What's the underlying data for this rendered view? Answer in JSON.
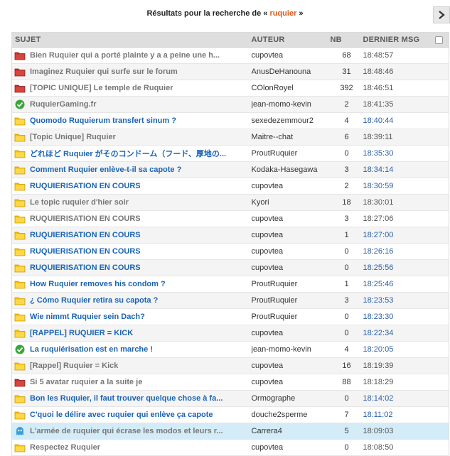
{
  "header": {
    "prefix": "Résultats pour la recherche de «",
    "query": "ruquier",
    "suffix": "»",
    "next_icon": "chevron-right-icon"
  },
  "columns": {
    "subject": "SUJET",
    "author": "AUTEUR",
    "count": "NB",
    "last": "DERNIER MSG"
  },
  "colors": {
    "folder_yellow": "#f5c000",
    "folder_red": "#c0302a",
    "check_green": "#3aa63a",
    "ghost_blue": "#3aa0d8",
    "link_blue": "#1a63b8",
    "link_grey": "#777777",
    "highlight_row": "#d4ecf7"
  },
  "topics": [
    {
      "icon": "red-folder-icon",
      "subject": "Bien Ruquier qui a porté plainte y a a peine une h...",
      "style": "grey",
      "author": "cupovtea",
      "count": "68",
      "last": "18:48:57"
    },
    {
      "icon": "red-folder-icon",
      "subject": "Imaginez Ruquier qui surfe sur le forum",
      "style": "grey",
      "author": "AnusDeHanouna",
      "count": "31",
      "last": "18:48:46"
    },
    {
      "icon": "red-folder-icon",
      "subject": "[TOPIC UNIQUE] Le temple de Ruquier",
      "style": "grey",
      "author": "COlonRoyel",
      "count": "392",
      "last": "18:46:51"
    },
    {
      "icon": "green-check-icon",
      "subject": "RuquierGaming.fr",
      "style": "grey",
      "author": "jean-momo-kevin",
      "count": "2",
      "last": "18:41:35"
    },
    {
      "icon": "yellow-folder-icon",
      "subject": "Quomodo Ruquierum transfert sinum ?",
      "style": "blue",
      "author": "sexedezemmour2",
      "count": "4",
      "last": "18:40:44"
    },
    {
      "icon": "yellow-folder-icon",
      "subject": "[Topic Unique] Ruquier",
      "style": "grey",
      "author": "Maitre--chat",
      "count": "6",
      "last": "18:39:11"
    },
    {
      "icon": "yellow-folder-icon",
      "subject": "どれほど Ruquier がそのコンドーム（フード、厚地の...",
      "style": "blue",
      "author": "ProutRuquier",
      "count": "0",
      "last": "18:35:30"
    },
    {
      "icon": "yellow-folder-icon",
      "subject": "Comment Ruquier enlève-t-il sa capote ?",
      "style": "blue",
      "author": "Kodaka-Hasegawa",
      "count": "3",
      "last": "18:34:14"
    },
    {
      "icon": "yellow-folder-icon",
      "subject": "RUQUIERISATION EN COURS",
      "style": "blue",
      "author": "cupovtea",
      "count": "2",
      "last": "18:30:59"
    },
    {
      "icon": "yellow-folder-icon",
      "subject": "Le topic ruquier d'hier soir",
      "style": "grey",
      "author": "Kyori",
      "count": "18",
      "last": "18:30:01"
    },
    {
      "icon": "yellow-folder-icon",
      "subject": "RUQUIERISATION EN COURS",
      "style": "grey",
      "author": "cupovtea",
      "count": "3",
      "last": "18:27:06"
    },
    {
      "icon": "yellow-folder-icon",
      "subject": "RUQUIERISATION EN COURS",
      "style": "blue",
      "author": "cupovtea",
      "count": "1",
      "last": "18:27:00"
    },
    {
      "icon": "yellow-folder-icon",
      "subject": "RUQUIERISATION EN COURS",
      "style": "blue",
      "author": "cupovtea",
      "count": "0",
      "last": "18:26:16"
    },
    {
      "icon": "yellow-folder-icon",
      "subject": "RUQUIERISATION EN COURS",
      "style": "blue",
      "author": "cupovtea",
      "count": "0",
      "last": "18:25:56"
    },
    {
      "icon": "yellow-folder-icon",
      "subject": "How Ruquier removes his condom ?",
      "style": "blue",
      "author": "ProutRuquier",
      "count": "1",
      "last": "18:25:46"
    },
    {
      "icon": "yellow-folder-icon",
      "subject": "¿ Cómo Ruquier retira su capota ?",
      "style": "blue",
      "author": "ProutRuquier",
      "count": "3",
      "last": "18:23:53"
    },
    {
      "icon": "yellow-folder-icon",
      "subject": "Wie nimmt Ruquier sein Dach?",
      "style": "blue",
      "author": "ProutRuquier",
      "count": "0",
      "last": "18:23:30"
    },
    {
      "icon": "yellow-folder-icon",
      "subject": "[RAPPEL] RUQUIER = KICK",
      "style": "blue",
      "author": "cupovtea",
      "count": "0",
      "last": "18:22:34"
    },
    {
      "icon": "green-check-icon",
      "subject": "La ruquiérisation est en marche !",
      "style": "blue",
      "author": "jean-momo-kevin",
      "count": "4",
      "last": "18:20:05"
    },
    {
      "icon": "yellow-folder-icon",
      "subject": "[Rappel] Ruquier = Kick",
      "style": "grey",
      "author": "cupovtea",
      "count": "16",
      "last": "18:19:39"
    },
    {
      "icon": "red-folder-icon",
      "subject": "Si 5 avatar ruquier a la suite je",
      "style": "grey",
      "author": "cupovtea",
      "count": "88",
      "last": "18:18:29"
    },
    {
      "icon": "yellow-folder-icon",
      "subject": "Bon les Ruquier, il faut trouver quelque chose à fa...",
      "style": "blue",
      "author": "Ormographe",
      "count": "0",
      "last": "18:14:02"
    },
    {
      "icon": "yellow-folder-icon",
      "subject": "C'quoi le délire avec ruquier qui enlève ça capote",
      "style": "blue",
      "author": "douche2sperme",
      "count": "7",
      "last": "18:11:02"
    },
    {
      "icon": "ghost-icon",
      "subject": "L'armée de ruquier qui écrase les modos et leurs r...",
      "style": "grey",
      "author": "Carrera4",
      "count": "5",
      "last": "18:09:03",
      "highlight": true
    },
    {
      "icon": "yellow-folder-icon",
      "subject": "Respectez Ruquier",
      "style": "grey",
      "author": "cupovtea",
      "count": "0",
      "last": "18:08:50"
    }
  ]
}
